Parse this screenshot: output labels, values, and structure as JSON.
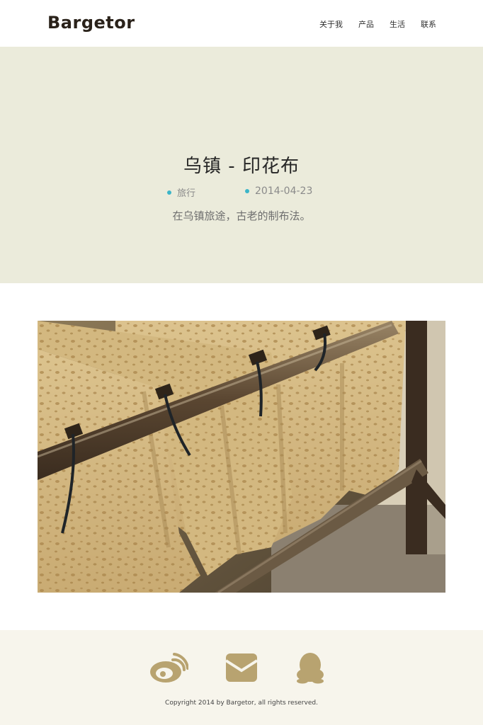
{
  "header": {
    "logo": "Bargetor",
    "nav": [
      "关于我",
      "产品",
      "生活",
      "联系"
    ]
  },
  "hero": {
    "title": "乌镇 - 印花布",
    "category": "旅行",
    "date": "2014-04-23",
    "description": "在乌镇旅途，古老的制布法。"
  },
  "photo": {
    "subject": "printed-cloth-drying-on-wooden-rack"
  },
  "footer": {
    "icons": [
      "weibo-icon",
      "mail-icon",
      "qq-icon"
    ],
    "copyright": "Copyright 2014 by Bargetor, all rights reserved."
  },
  "colors": {
    "hero_bg": "#ebebdb",
    "footer_bg": "#f7f5ec",
    "accent_dot": "#3bb5c8",
    "icon_gold": "#b8a370"
  }
}
